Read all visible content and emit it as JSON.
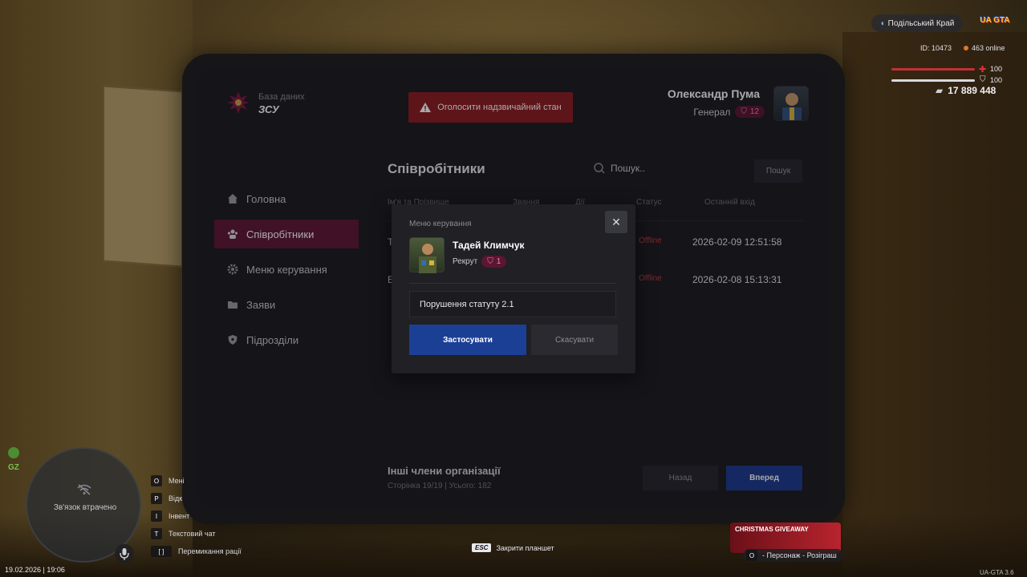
{
  "tablet": {
    "db_label": "База даних",
    "db_name": "ЗСУ",
    "emergency_label": "Оголосити надзвичайний стан",
    "user": {
      "name": "Олександр Пума",
      "rank": "Генерал",
      "rank_level": "12"
    }
  },
  "sidebar": {
    "items": [
      {
        "label": "Головна",
        "icon": "home-icon"
      },
      {
        "label": "Співробітники",
        "icon": "users-icon",
        "active": true
      },
      {
        "label": "Меню керування",
        "icon": "gear-icon"
      },
      {
        "label": "Заяви",
        "icon": "folder-icon"
      },
      {
        "label": "Підрозділи",
        "icon": "shield-icon"
      }
    ]
  },
  "main": {
    "title": "Співробітники",
    "search_placeholder": "Пошук..",
    "search_button": "Пошук",
    "columns": [
      "Ім'я та Прізвище",
      "Звання",
      "Дії",
      "Статус",
      "Останній вхід"
    ],
    "rows": [
      {
        "name_initial": "Т",
        "status": "Offline",
        "last_login": "2026-02-09 12:51:58"
      },
      {
        "name_initial": "Б",
        "status": "Offline",
        "last_login": "2026-02-08 15:13:31"
      }
    ],
    "footer_title": "Інші члени організації",
    "footer_sub": "Сторінка 19/19 | Усього: 182",
    "back_button": "Назад",
    "next_button": "Вперед"
  },
  "modal": {
    "title": "Меню керування",
    "member_name": "Тадей Климчук",
    "member_rank": "Рекрут",
    "member_rank_level": "1",
    "reason_value": "Порушення статуту 2.1",
    "apply_button": "Застосувати",
    "cancel_button": "Скасувати"
  },
  "hud": {
    "server": "Подільський Край",
    "id": "ID: 10473",
    "online": "463 online",
    "health": "100",
    "armor": "100",
    "money": "17 889 448",
    "gz": "GZ",
    "connection_lost": "Зв'язок втрачено",
    "datetime": "19.02.2026 | 19:06",
    "hints": [
      {
        "key": "O",
        "label": "Мені"
      },
      {
        "key": "P",
        "label": "Відк"
      },
      {
        "key": "I",
        "label": "Інвент"
      },
      {
        "key": "T",
        "label": "Текстовий чат"
      },
      {
        "key": "[ ]",
        "label": "Перемикання рації"
      }
    ],
    "esc_key": "ESC",
    "esc_label": "Закрити планшет",
    "promo_title": "CHRISTMAS GIVEAWAY",
    "promo_hint_key": "O",
    "promo_hint": "- Персонаж - Розіграш",
    "version": "UA-GTA 3.6"
  },
  "colors": {
    "accent_active": "#5e1635",
    "primary_button": "#1c3f96",
    "emergency": "#8c1c1f",
    "offline": "#c0383a"
  }
}
